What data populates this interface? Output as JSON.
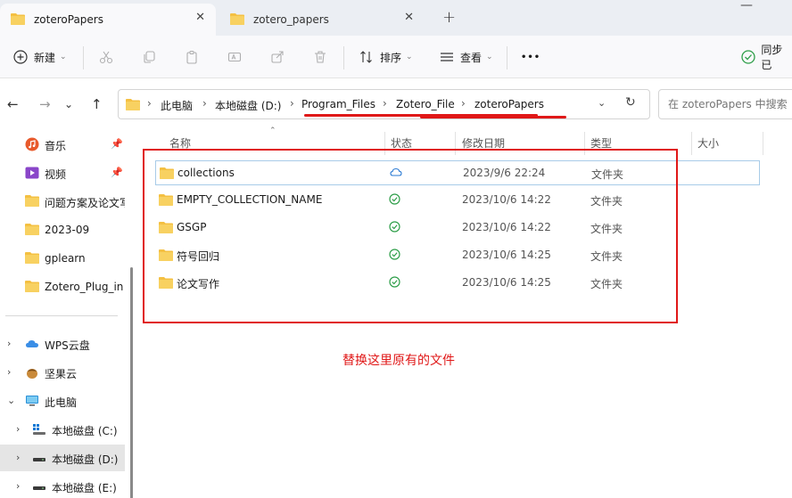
{
  "tabs": [
    {
      "label": "zoteroPapers",
      "close": "✕"
    },
    {
      "label": "zotero_papers",
      "close": "✕"
    }
  ],
  "new_tab_symbol": "+",
  "window_minimize_symbol": "—",
  "toolbar": {
    "new_label": "新建",
    "sort_label": "排序",
    "view_label": "查看",
    "more_symbol": "•••",
    "sync_label": "同步已"
  },
  "breadcrumb": [
    "此电脑",
    "本地磁盘 (D:)",
    "Program_Files",
    "Zotero_File",
    "zoteroPapers"
  ],
  "breadcrumb_separator": "›",
  "search": {
    "placeholder": "在 zoteroPapers 中搜索"
  },
  "sidebar": {
    "quick": [
      {
        "label": "音乐",
        "icon": "music-icon",
        "pinned": true
      },
      {
        "label": "视频",
        "icon": "video-icon",
        "pinned": true
      },
      {
        "label": "问题方案及论文写",
        "icon": "folder-icon",
        "pinned": false
      },
      {
        "label": "2023-09",
        "icon": "folder-icon",
        "pinned": false
      },
      {
        "label": "gplearn",
        "icon": "folder-icon",
        "pinned": false
      },
      {
        "label": "Zotero_Plug_in",
        "icon": "folder-icon",
        "pinned": false
      }
    ],
    "tree": [
      {
        "label": "WPS云盘",
        "icon": "cloud-icon"
      },
      {
        "label": "坚果云",
        "icon": "nut-icon"
      },
      {
        "label": "此电脑",
        "icon": "computer-icon"
      },
      {
        "label": "本地磁盘 (C:)",
        "icon": "drive-icon"
      },
      {
        "label": "本地磁盘 (D:)",
        "icon": "drive-icon"
      },
      {
        "label": "本地磁盘 (E:)",
        "icon": "drive-icon"
      }
    ]
  },
  "columns": {
    "name": "名称",
    "status": "状态",
    "modified": "修改日期",
    "type": "类型",
    "size": "大小"
  },
  "files": [
    {
      "name": "collections",
      "status": "cloud",
      "modified": "2023/9/6 22:24",
      "type": "文件夹"
    },
    {
      "name": "EMPTY_COLLECTION_NAME",
      "status": "synced",
      "modified": "2023/10/6 14:22",
      "type": "文件夹"
    },
    {
      "name": "GSGP",
      "status": "synced",
      "modified": "2023/10/6 14:22",
      "type": "文件夹"
    },
    {
      "name": "符号回归",
      "status": "synced",
      "modified": "2023/10/6 14:25",
      "type": "文件夹"
    },
    {
      "name": "论文写作",
      "status": "synced",
      "modified": "2023/10/6 14:25",
      "type": "文件夹"
    }
  ],
  "annotation": "替换这里原有的文件",
  "colors": {
    "annotation": "#e01818",
    "folder": "#f4c042",
    "synced": "#2e9e49",
    "cloud": "#2a7ad3"
  }
}
